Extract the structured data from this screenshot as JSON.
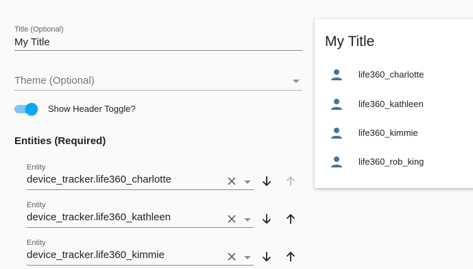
{
  "editor": {
    "title_field": {
      "label": "Title (Optional)",
      "value": "My Title"
    },
    "theme_field": {
      "placeholder": "Theme (Optional)"
    },
    "header_toggle": {
      "label": "Show Header Toggle?",
      "on": true
    },
    "entities_heading": "Entities (Required)",
    "entities": [
      {
        "label": "Entity",
        "value": "device_tracker.life360_charlotte",
        "up_disabled": true
      },
      {
        "label": "Entity",
        "value": "device_tracker.life360_kathleen",
        "up_disabled": false
      },
      {
        "label": "Entity",
        "value": "device_tracker.life360_kimmie",
        "up_disabled": false
      }
    ]
  },
  "preview": {
    "title": "My Title",
    "rows": [
      {
        "label": "life360_charlotte",
        "icon": "person-icon"
      },
      {
        "label": "life360_kathleen",
        "icon": "person-icon"
      },
      {
        "label": "life360_kimmie",
        "icon": "person-icon"
      },
      {
        "label": "life360_rob_king",
        "icon": "person-icon"
      }
    ]
  },
  "colors": {
    "accent": "#03a9f4",
    "toggle_track": "#7cc6f4",
    "person_icon": "#44739e",
    "icon_dark": "#212121",
    "icon_disabled": "#bdbdbd"
  }
}
